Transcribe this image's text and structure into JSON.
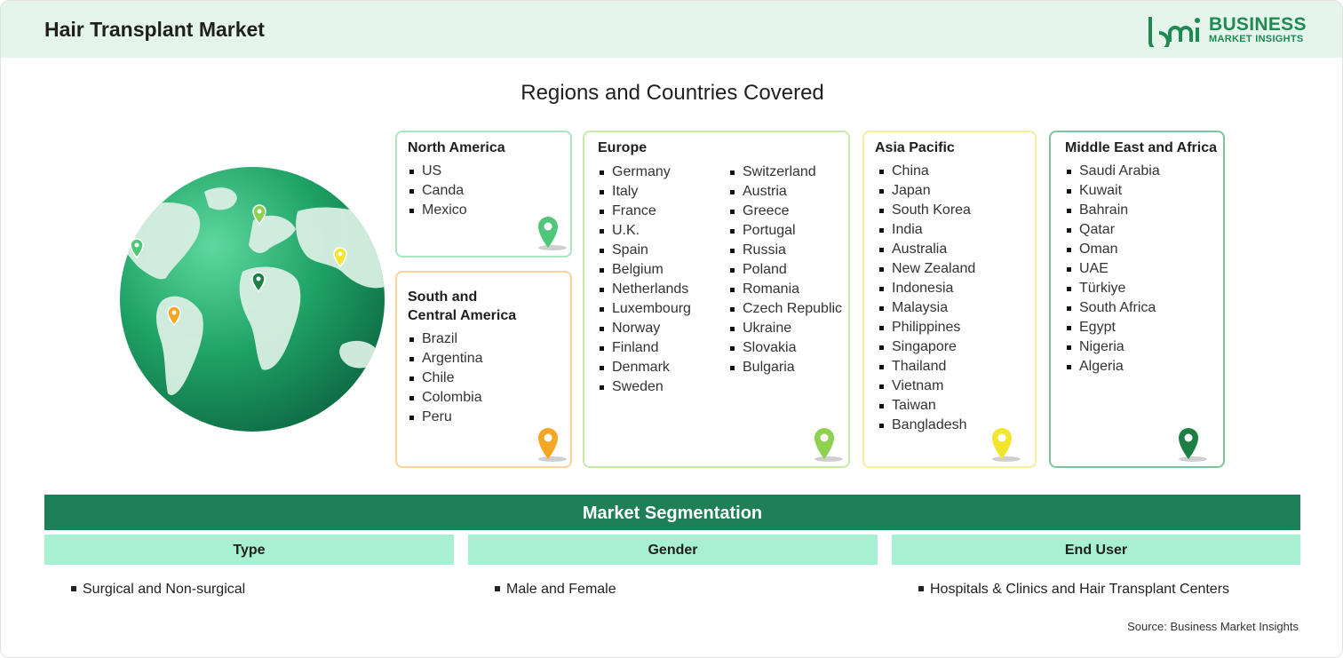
{
  "header": {
    "title": "Hair Transplant Market",
    "logo_line1": "BUSINESS",
    "logo_line2": "MARKET INSIGHTS"
  },
  "regions_title": "Regions and Countries Covered",
  "regions": {
    "north_america": {
      "title": "North America",
      "countries": [
        "US",
        "Canda",
        "Mexico"
      ],
      "color": "#4fc77a"
    },
    "south_central_america": {
      "title_line1": "South and",
      "title_line2": "Central America",
      "countries": [
        "Brazil",
        "Argentina",
        "Chile",
        "Colombia",
        "Peru"
      ],
      "color": "#f5a623"
    },
    "europe": {
      "title": "Europe",
      "col1": [
        "Germany",
        "Italy",
        "France",
        "U.K.",
        "Spain",
        "Belgium",
        "Netherlands",
        "Luxembourg",
        "Norway",
        "Finland",
        "Denmark",
        "Sweden"
      ],
      "col2": [
        "Switzerland",
        "Austria",
        "Greece",
        "Portugal",
        "Russia",
        "Poland",
        "Romania",
        "Czech Republic",
        "Ukraine",
        "Slovakia",
        "Bulgaria"
      ],
      "color": "#8fd14f"
    },
    "asia_pacific": {
      "title": "Asia Pacific",
      "countries": [
        "China",
        "Japan",
        "South Korea",
        "India",
        "Australia",
        "New Zealand",
        "Indonesia",
        "Malaysia",
        "Philippines",
        "Singapore",
        "Thailand",
        "Vietnam",
        "Taiwan",
        "Bangladesh"
      ],
      "color": "#f2e52e"
    },
    "middle_east_africa": {
      "title": "Middle East and Africa",
      "countries": [
        "Saudi Arabia",
        "Kuwait",
        "Bahrain",
        "Qatar",
        "Oman",
        "UAE",
        "Türkiye",
        "South Africa",
        "Egypt",
        "Nigeria",
        "Algeria"
      ],
      "color": "#1e7f45"
    }
  },
  "segmentation": {
    "title": "Market Segmentation",
    "columns": [
      {
        "header": "Type",
        "item": "Surgical and Non-surgical"
      },
      {
        "header": "Gender",
        "item": "Male and Female"
      },
      {
        "header": "End User",
        "item": "Hospitals & Clinics and Hair Transplant Centers"
      }
    ]
  },
  "source": "Source: Business Market Insights",
  "colors": {
    "brand_green": "#1e8a52",
    "segment_bar": "#1f7f57",
    "segment_header": "#a8f0d2",
    "header_bg": "#e6f5ec"
  }
}
